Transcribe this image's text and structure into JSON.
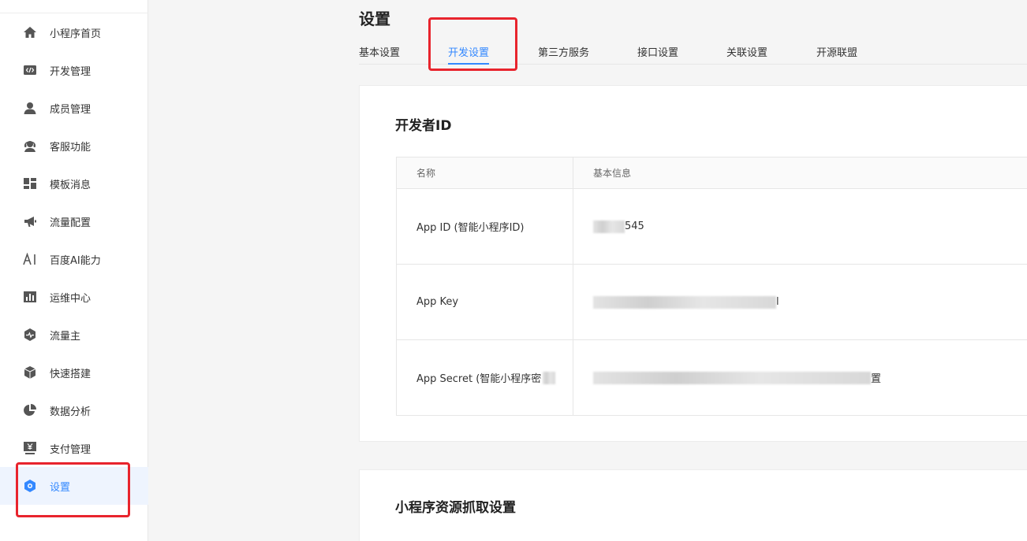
{
  "sidebar": {
    "items": [
      {
        "label": "小程序首页",
        "icon": "home-icon"
      },
      {
        "label": "开发管理",
        "icon": "code-icon"
      },
      {
        "label": "成员管理",
        "icon": "user-icon"
      },
      {
        "label": "客服功能",
        "icon": "headset-icon"
      },
      {
        "label": "模板消息",
        "icon": "template-icon"
      },
      {
        "label": "流量配置",
        "icon": "megaphone-icon"
      },
      {
        "label": "百度AI能力",
        "icon": "ai-icon"
      },
      {
        "label": "运维中心",
        "icon": "bar-chart-icon"
      },
      {
        "label": "流量主",
        "icon": "hexagon-pulse-icon"
      },
      {
        "label": "快速搭建",
        "icon": "cube-icon"
      },
      {
        "label": "数据分析",
        "icon": "pie-chart-icon"
      },
      {
        "label": "支付管理",
        "icon": "payment-icon"
      },
      {
        "label": "设置",
        "icon": "settings-icon"
      }
    ],
    "active_index": 12
  },
  "main": {
    "title": "设置",
    "tabs": [
      "基本设置",
      "开发设置",
      "第三方服务",
      "接口设置",
      "关联设置",
      "开源联盟"
    ],
    "active_tab": 1
  },
  "developer_card": {
    "title": "开发者ID",
    "table": {
      "headers": [
        "名称",
        "基本信息"
      ],
      "rows": [
        {
          "name": "App ID (智能小程序ID)",
          "value_tail": "545"
        },
        {
          "name": "App Key",
          "value_tail": "l"
        },
        {
          "name": "App Secret (智能小程序密",
          "value_tail": "置"
        }
      ]
    }
  },
  "resource_card": {
    "title": "小程序资源抓取设置"
  },
  "colors": {
    "accent": "#3388ff",
    "highlight_red": "#e8242d",
    "icon_gray": "#555555"
  }
}
